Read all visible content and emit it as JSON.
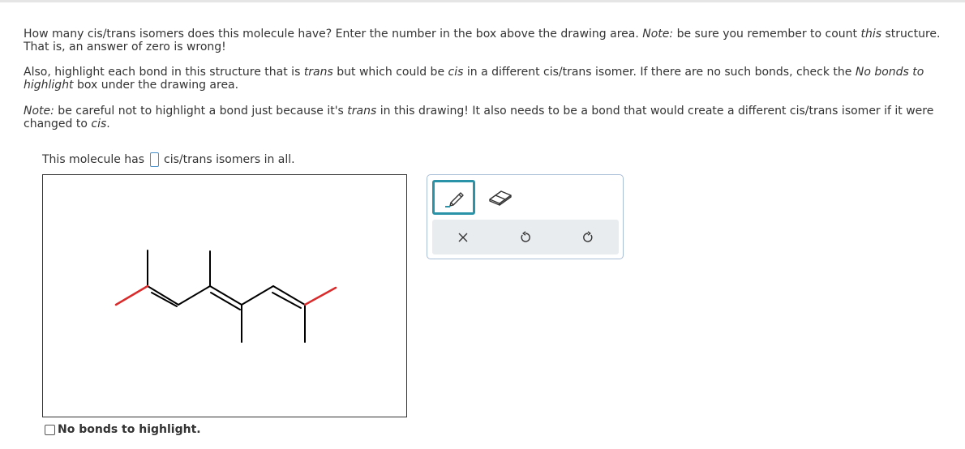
{
  "question": {
    "p1": {
      "a": "How many cis/trans isomers does this molecule have? Enter the number in the box above the drawing area. ",
      "note_label": "Note:",
      "b": " be sure you remember to count ",
      "this": "this",
      "c": " structure. That is, an answer of zero is wrong!"
    },
    "p2": {
      "a": "Also, highlight each bond in this structure that is ",
      "trans": "trans",
      "b": " but which could be ",
      "cis": "cis",
      "c": " in a different cis/trans isomer. If there are no such bonds, check the ",
      "nobonds": "No bonds to highlight",
      "d": " box under the drawing area."
    },
    "p3": {
      "note_label": "Note:",
      "a": " be careful not to highlight a bond just because it's ",
      "trans": "trans",
      "b": " in this drawing! It also needs to be a bond that would create a different cis/trans isomer if it were changed to ",
      "cis": "cis",
      "c": "."
    }
  },
  "answer": {
    "prefix": "This molecule has",
    "suffix": "cis/trans isomers in all.",
    "value": ""
  },
  "toolbar": {
    "pencil": "pencil-icon",
    "eraser": "eraser-icon",
    "clear": "x-icon",
    "undo": "undo-icon",
    "redo": "redo-icon",
    "active_color": "#2a93a8"
  },
  "molecule": {
    "bond_color": "#000000",
    "highlight_color": "#d92b2b"
  },
  "checkbox": {
    "label": "No bonds to highlight.",
    "checked": false
  }
}
